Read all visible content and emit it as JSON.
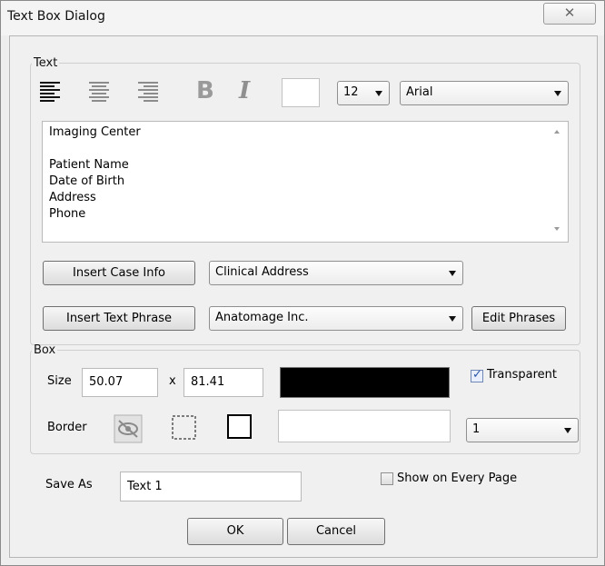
{
  "window": {
    "title": "Text Box Dialog",
    "close_glyph": "✕"
  },
  "text_group": {
    "legend": "Text",
    "toolbar": {
      "align_left_icon": "align-left-icon",
      "align_center_icon": "align-center-icon",
      "align_right_icon": "align-right-icon",
      "bold_label": "B",
      "italic_label": "I",
      "color_swatch": "#ffffff",
      "font_size": "12",
      "font_family": "Arial"
    },
    "content_lines": [
      "Imaging Center",
      "",
      "Patient Name",
      "Date of Birth",
      "Address",
      "Phone"
    ],
    "insert_case_info_label": "Insert Case Info",
    "case_info_selected": "Clinical Address",
    "insert_text_phrase_label": "Insert Text Phrase",
    "phrase_selected": "Anatomage Inc.",
    "edit_phrases_label": "Edit Phrases"
  },
  "box_group": {
    "legend": "Box",
    "size_label": "Size",
    "width": "50.07",
    "x_label": "x",
    "height": "81.41",
    "fill_color": "#000000",
    "transparent_label": "Transparent",
    "transparent_checked": true,
    "border_label": "Border",
    "border_style_icons": [
      "no-border-icon",
      "dashed-border-icon",
      "solid-border-icon"
    ],
    "border_color": "#ffffff",
    "border_width": "1"
  },
  "save_as": {
    "label": "Save As",
    "value": "Text 1",
    "show_every_page_label": "Show on Every Page",
    "show_every_page_checked": false
  },
  "buttons": {
    "ok": "OK",
    "cancel": "Cancel"
  },
  "colors": {
    "accent_check": "#2a55a8",
    "window_bg": "#eeeeee"
  }
}
